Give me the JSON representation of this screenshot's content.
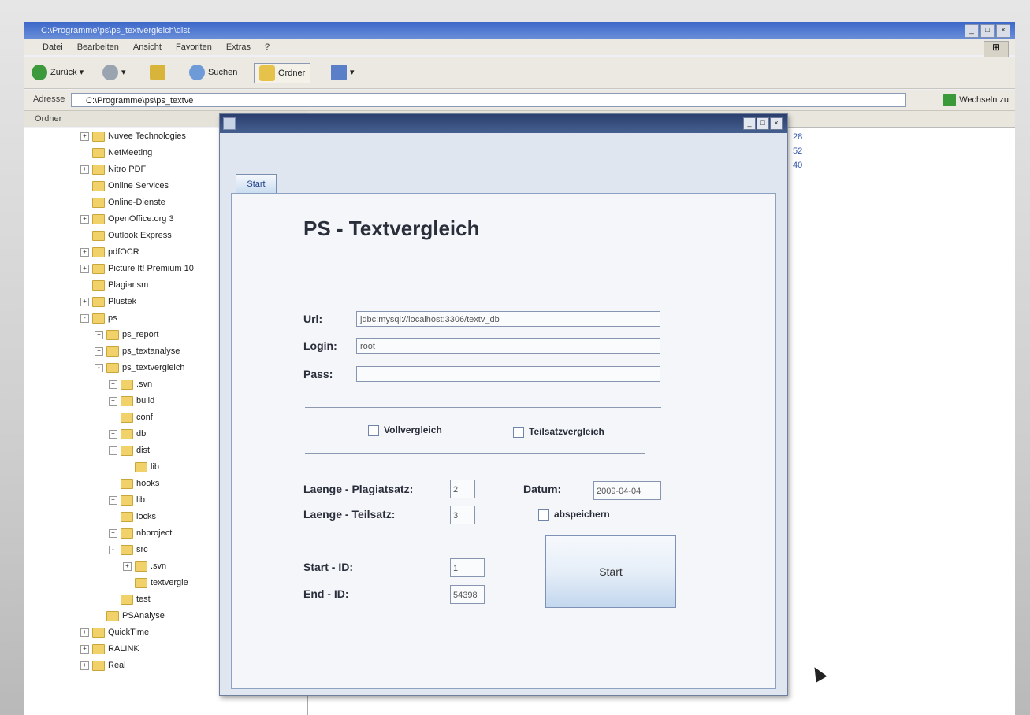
{
  "explorer": {
    "title": "C:\\Programme\\ps\\ps_textvergleich\\dist",
    "menu": [
      "Datei",
      "Bearbeiten",
      "Ansicht",
      "Favoriten",
      "Extras",
      "?"
    ],
    "toolbar": {
      "back": "Zurück",
      "search": "Suchen",
      "folders": "Ordner"
    },
    "address_label": "Adresse",
    "address_value": "C:\\Programme\\ps\\ps_textve",
    "go_label": "Wechseln zu",
    "folders_header": "Ordner",
    "tree": [
      {
        "label": "Nuvee Technologies",
        "indent": 1,
        "exp": "+"
      },
      {
        "label": "NetMeeting",
        "indent": 1,
        "exp": ""
      },
      {
        "label": "Nitro PDF",
        "indent": 1,
        "exp": "+"
      },
      {
        "label": "Online Services",
        "indent": 1,
        "exp": ""
      },
      {
        "label": "Online-Dienste",
        "indent": 1,
        "exp": ""
      },
      {
        "label": "OpenOffice.org 3",
        "indent": 1,
        "exp": "+"
      },
      {
        "label": "Outlook Express",
        "indent": 1,
        "exp": ""
      },
      {
        "label": "pdfOCR",
        "indent": 1,
        "exp": "+"
      },
      {
        "label": "Picture It! Premium 10",
        "indent": 1,
        "exp": "+"
      },
      {
        "label": "Plagiarism",
        "indent": 1,
        "exp": ""
      },
      {
        "label": "Plustek",
        "indent": 1,
        "exp": "+"
      },
      {
        "label": "ps",
        "indent": 1,
        "exp": "-"
      },
      {
        "label": "ps_report",
        "indent": 2,
        "exp": "+"
      },
      {
        "label": "ps_textanalyse",
        "indent": 2,
        "exp": "+"
      },
      {
        "label": "ps_textvergleich",
        "indent": 2,
        "exp": "-"
      },
      {
        "label": ".svn",
        "indent": 3,
        "exp": "+"
      },
      {
        "label": "build",
        "indent": 3,
        "exp": "+"
      },
      {
        "label": "conf",
        "indent": 3,
        "exp": ""
      },
      {
        "label": "db",
        "indent": 3,
        "exp": "+"
      },
      {
        "label": "dist",
        "indent": 3,
        "exp": "-"
      },
      {
        "label": "lib",
        "indent": 4,
        "exp": ""
      },
      {
        "label": "hooks",
        "indent": 3,
        "exp": ""
      },
      {
        "label": "lib",
        "indent": 3,
        "exp": "+"
      },
      {
        "label": "locks",
        "indent": 3,
        "exp": ""
      },
      {
        "label": "nbproject",
        "indent": 3,
        "exp": "+"
      },
      {
        "label": "src",
        "indent": 3,
        "exp": "-"
      },
      {
        "label": ".svn",
        "indent": 4,
        "exp": "+"
      },
      {
        "label": "textvergle",
        "indent": 4,
        "exp": ""
      },
      {
        "label": "test",
        "indent": 3,
        "exp": ""
      },
      {
        "label": "PSAnalyse",
        "indent": 2,
        "exp": ""
      },
      {
        "label": "QuickTime",
        "indent": 1,
        "exp": "+"
      },
      {
        "label": "RALINK",
        "indent": 1,
        "exp": "+"
      },
      {
        "label": "Real",
        "indent": 1,
        "exp": "+"
      }
    ],
    "sizes": [
      "28",
      "52",
      "40"
    ]
  },
  "dialog": {
    "tab": "Start",
    "title": "PS - Textvergleich",
    "url_label": "Url:",
    "url_value": "jdbc:mysql://localhost:3306/textv_db",
    "login_label": "Login:",
    "login_value": "root",
    "pass_label": "Pass:",
    "pass_value": "",
    "voll_label": "Vollvergleich",
    "teil_label": "Teilsatzvergleich",
    "laenge_plagiat_label": "Laenge - Plagiatsatz:",
    "laenge_plagiat_value": "2",
    "laenge_teil_label": "Laenge - Teilsatz:",
    "laenge_teil_value": "3",
    "datum_label": "Datum:",
    "datum_value": "2009-04-04",
    "abspeichern_label": "abspeichern",
    "start_id_label": "Start - ID:",
    "start_id_value": "1",
    "end_id_label": "End - ID:",
    "end_id_value": "54398",
    "start_button": "Start"
  }
}
